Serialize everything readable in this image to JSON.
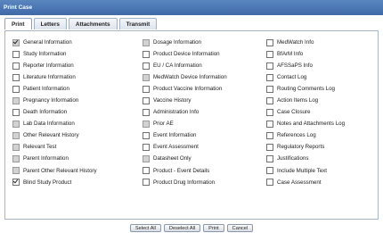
{
  "title": "Print Case",
  "tabs": [
    "Print",
    "Letters",
    "Attachments",
    "Transmit"
  ],
  "options": [
    {
      "label": "General Information",
      "checked": true,
      "disabled": true
    },
    {
      "label": "Dosage Information",
      "checked": false,
      "disabled": true
    },
    {
      "label": "MedWatch Info",
      "checked": false,
      "disabled": false
    },
    {
      "label": "Study Information",
      "checked": false,
      "disabled": false
    },
    {
      "label": "Product Device Information",
      "checked": false,
      "disabled": false
    },
    {
      "label": "BfArM Info",
      "checked": false,
      "disabled": false
    },
    {
      "label": "Reporter Information",
      "checked": false,
      "disabled": false
    },
    {
      "label": "EU / CA Information",
      "checked": false,
      "disabled": false
    },
    {
      "label": "AFSSaPS Info",
      "checked": false,
      "disabled": false
    },
    {
      "label": "Literature Information",
      "checked": false,
      "disabled": false
    },
    {
      "label": "MedWatch Device Information",
      "checked": false,
      "disabled": true
    },
    {
      "label": "Contact Log",
      "checked": false,
      "disabled": false
    },
    {
      "label": "Patient Information",
      "checked": false,
      "disabled": false
    },
    {
      "label": "Product Vaccine Information",
      "checked": false,
      "disabled": false
    },
    {
      "label": "Routing Comments Log",
      "checked": false,
      "disabled": false
    },
    {
      "label": "Pregnancy Information",
      "checked": false,
      "disabled": true
    },
    {
      "label": "Vaccine History",
      "checked": false,
      "disabled": false
    },
    {
      "label": "Action Items Log",
      "checked": false,
      "disabled": false
    },
    {
      "label": "Death Information",
      "checked": false,
      "disabled": false
    },
    {
      "label": "Administration Info",
      "checked": false,
      "disabled": false
    },
    {
      "label": "Case Closure",
      "checked": false,
      "disabled": false
    },
    {
      "label": "Lab Data Information",
      "checked": false,
      "disabled": true
    },
    {
      "label": "Prior AE",
      "checked": false,
      "disabled": true
    },
    {
      "label": "Notes and Attachments Log",
      "checked": false,
      "disabled": false
    },
    {
      "label": "Other Relevant History",
      "checked": false,
      "disabled": true
    },
    {
      "label": "Event Information",
      "checked": false,
      "disabled": false
    },
    {
      "label": "References Log",
      "checked": false,
      "disabled": false
    },
    {
      "label": "Relevant Test",
      "checked": false,
      "disabled": true
    },
    {
      "label": "Event Assessment",
      "checked": false,
      "disabled": false
    },
    {
      "label": "Regulatory Reports",
      "checked": false,
      "disabled": false
    },
    {
      "label": "Parent Information",
      "checked": false,
      "disabled": true
    },
    {
      "label": "Datasheet Only",
      "checked": false,
      "disabled": true
    },
    {
      "label": "Justifications",
      "checked": false,
      "disabled": false
    },
    {
      "label": "Parent Other Relevant History",
      "checked": false,
      "disabled": true
    },
    {
      "label": "Product - Event Details",
      "checked": false,
      "disabled": false
    },
    {
      "label": "Include Multiple Text",
      "checked": false,
      "disabled": false
    },
    {
      "label": "Blind Study Product",
      "checked": true,
      "disabled": false
    },
    {
      "label": "Product Drug Information",
      "checked": false,
      "disabled": false
    },
    {
      "label": "Case Assessment",
      "checked": false,
      "disabled": false
    }
  ],
  "buttons": [
    "Select All",
    "Deselect All",
    "Print",
    "Cancel"
  ]
}
